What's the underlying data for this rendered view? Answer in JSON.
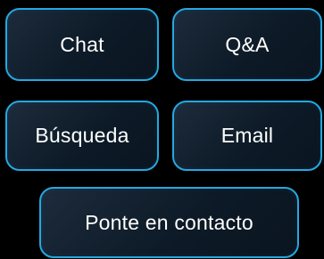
{
  "buttons": {
    "chat": "Chat",
    "qa": "Q&A",
    "busqueda": "Búsqueda",
    "email": "Email",
    "contacto": "Ponte en contacto"
  },
  "colors": {
    "background": "#000000",
    "button_border": "#26a8e0",
    "button_fill_top": "#1d2b3c",
    "button_fill_bottom": "#0a1520",
    "text": "#ffffff"
  }
}
